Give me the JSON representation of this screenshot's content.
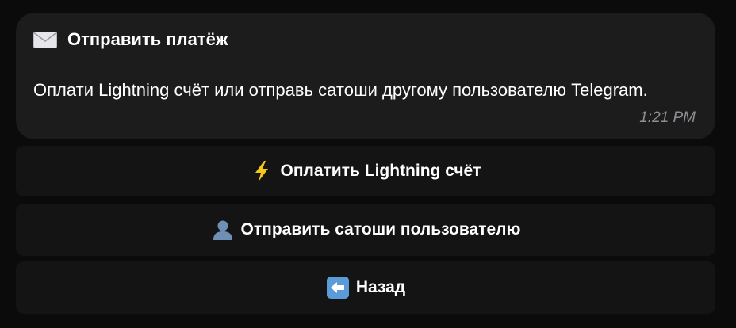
{
  "message": {
    "title": "Отправить платёж",
    "text": "Оплати Lightning счёт или отправь сатоши другому пользователю Telegram.",
    "time": "1:21 PM"
  },
  "buttons": [
    {
      "label": "Оплатить Lightning счёт",
      "icon": "lightning-icon"
    },
    {
      "label": "Отправить сатоши пользователю",
      "icon": "user-silhouette-icon"
    },
    {
      "label": "Назад",
      "icon": "back-arrow-icon"
    }
  ],
  "colors": {
    "background": "#0b0b0b",
    "bubble": "#1c1c1d",
    "button": "#141414",
    "text": "#ffffff",
    "time": "#8e8e93"
  }
}
